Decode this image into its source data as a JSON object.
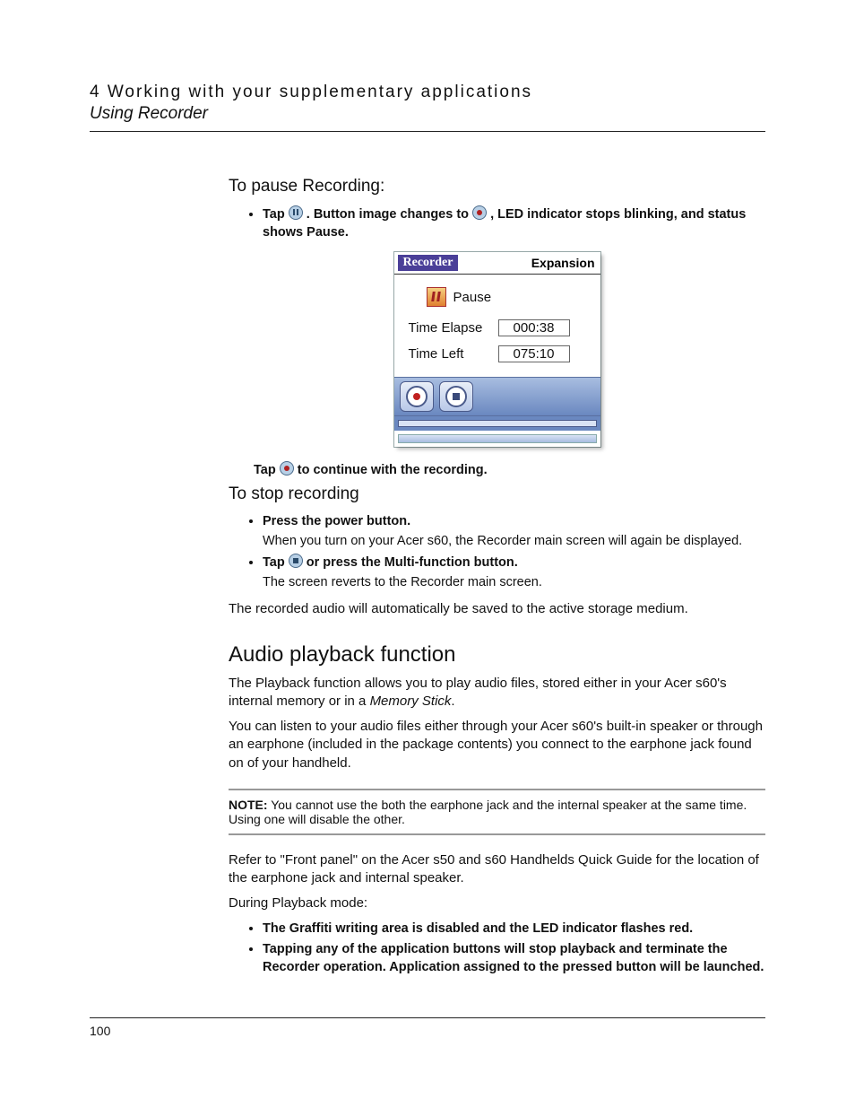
{
  "header": {
    "chapter": "4 Working with your supplementary applications",
    "section": "Using Recorder"
  },
  "sect_pause": {
    "title": "To pause Recording:",
    "bullet1_a": "Tap ",
    "bullet1_b": ". Button image changes to ",
    "bullet1_c": ", LED indicator stops blinking, and status shows Pause.",
    "cont_a": "Tap ",
    "cont_b": " to continue with the recording."
  },
  "shot": {
    "title_left": "Recorder",
    "title_right": "Expansion",
    "status": "Pause",
    "row1_label": "Time Elapse",
    "row1_val": "000:38",
    "row2_label": "Time Left",
    "row2_val": "075:10"
  },
  "sect_stop": {
    "title": "To stop recording",
    "b1": "Press the power button.",
    "b1_sub": "When you turn on your Acer s60, the Recorder main screen will again be displayed.",
    "b2_a": "Tap ",
    "b2_b": " or press the Multi-function button.",
    "b2_sub": "The screen reverts to the Recorder main screen.",
    "closing": "The recorded audio will automatically be saved to the active storage medium."
  },
  "sect_audio": {
    "title": "Audio playback function",
    "p1_a": "The Playback function allows you to play audio files, stored either in your Acer s60's internal memory or in a ",
    "p1_em": "Memory Stick",
    "p1_b": ".",
    "p2": "You can listen to your audio files either through your Acer s60's built-in speaker or through an earphone (included in the package contents) you connect to the earphone jack found on of your handheld.",
    "note_label": "NOTE:",
    "note": "  You cannot use the both the earphone jack and the internal speaker at the same time. Using one will disable the other.",
    "p3": "Refer to \"Front panel\" on the Acer s50 and s60 Handhelds Quick Guide for the location of the earphone jack and internal speaker.",
    "p4": "During Playback mode:",
    "b1": "The Graffiti writing area is disabled and the LED indicator flashes red.",
    "b2": "Tapping any of the application buttons will stop playback and terminate the Recorder operation. Application assigned to the pressed button will be launched."
  },
  "page_number": "100"
}
